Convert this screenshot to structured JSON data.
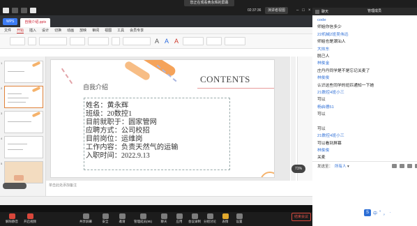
{
  "meeting": {
    "share_banner": "您正在观看黄永辉的屏幕",
    "timer": "02:37:36",
    "view_mode": "演讲者视图",
    "leave_label": "结束会议"
  },
  "presentation": {
    "app_button": "WPS",
    "tab_label": "自我介绍.pptx",
    "menu": [
      "文件",
      "开始",
      "插入",
      "设计",
      "切换",
      "动画",
      "放映",
      "审阅",
      "视图",
      "工具",
      "会员专享"
    ],
    "active_menu": "开始",
    "slide": {
      "title": "自我介绍",
      "contents": "CONTENTS",
      "lines": [
        "姓名：黄永辉",
        "班级：20数控1",
        "目前就职于：圆家管网",
        "应聘方式：公司校招",
        "目前岗位：运维岗",
        "工作内容：负责天然气的运输",
        "入职时间：2022.9.13"
      ]
    },
    "zoom": "71%",
    "note_hint": "单击此处添加备注"
  },
  "dock": {
    "items": [
      "解除静音",
      "开启视频",
      "共享屏幕",
      "安全",
      "邀请",
      "管理成员(95)",
      "聊天",
      "应用",
      "会议录制",
      "分组讨论",
      "表情",
      "设置"
    ]
  },
  "chat": {
    "title": "聊天",
    "manage_title": "管理成员",
    "messages": [
      {
        "kind": "name",
        "text": "code"
      },
      {
        "kind": "text",
        "text": "师姐你信多少"
      },
      {
        "kind": "name",
        "text": "22机械2班吴伟迅"
      },
      {
        "kind": "text",
        "text": "师姐也是潮汕人"
      },
      {
        "kind": "name",
        "text": "大炫东"
      },
      {
        "kind": "text",
        "text": "脱己人"
      },
      {
        "kind": "name",
        "text": "林俊金"
      },
      {
        "kind": "text",
        "text": "庄丹丹同学是不是忘记关麦了"
      },
      {
        "kind": "name",
        "text": "林俊俊"
      },
      {
        "kind": "text",
        "text": "认识这些同学的班匹通知一下她"
      },
      {
        "kind": "name",
        "text": "21数控4班小三"
      },
      {
        "kind": "text",
        "text": "可以"
      },
      {
        "kind": "name",
        "text": "杨启德51"
      },
      {
        "kind": "text",
        "text": "可以"
      },
      {
        "kind": "name",
        "text": ""
      },
      {
        "kind": "text",
        "text": "可以"
      },
      {
        "kind": "name",
        "text": "21数控4班小三"
      },
      {
        "kind": "text",
        "text": "可以看到屏幕"
      },
      {
        "kind": "name",
        "text": "林俊俊"
      },
      {
        "kind": "text",
        "text": "关麦"
      }
    ],
    "send_to_label": "发送至：",
    "send_to_target": "所有人"
  },
  "ime": {
    "label": "中",
    "extras": [
      "°",
      "，",
      "·"
    ]
  }
}
